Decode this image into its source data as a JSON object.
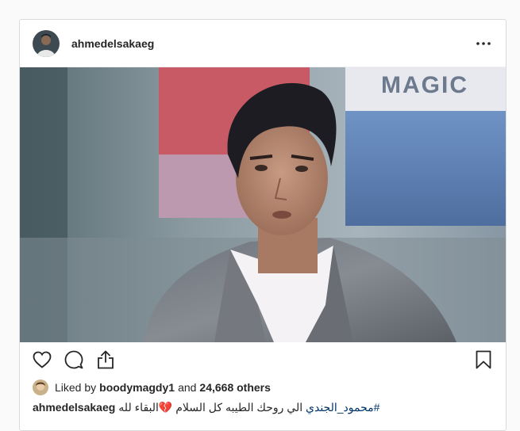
{
  "post": {
    "username": "ahmedelsakaeg",
    "more_icon": "ellipsis-icon",
    "likes": {
      "prefix": "Liked by",
      "liker": "boodymagdy1",
      "conjunction": "and",
      "others": "24,668 others"
    },
    "caption": {
      "username": "ahmedelsakaeg",
      "hashtag": "#محمود_الجندي",
      "text": "الي روحك الطيبه كل السلام 💔البقاء لله"
    },
    "photo_sign_text": "MAGIC"
  },
  "icons": {
    "like": "heart-icon",
    "comment": "comment-icon",
    "share": "share-icon",
    "save": "bookmark-icon"
  },
  "colors": {
    "text": "#262626",
    "border": "#dbdbdb",
    "hashtag": "#003569"
  }
}
